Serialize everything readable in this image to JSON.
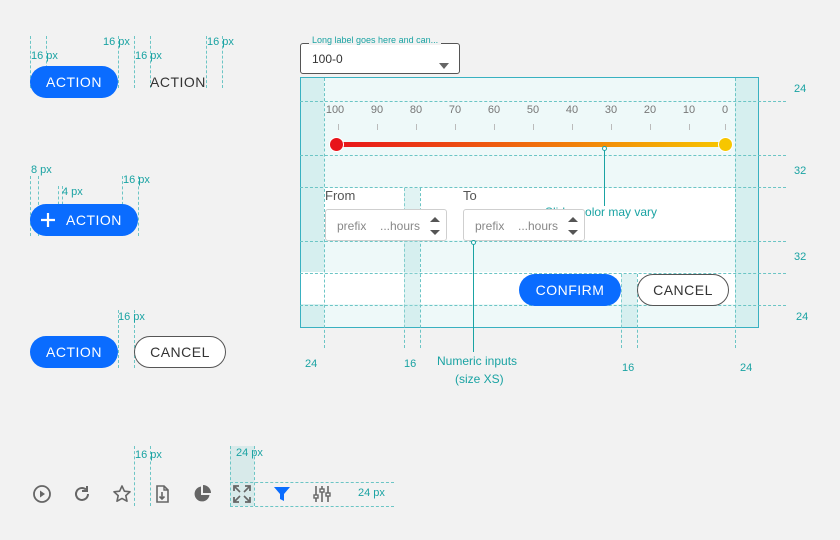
{
  "buttons": {
    "action_label": "ACTION",
    "cancel_label": "CANCEL",
    "confirm_label": "CONFIRM"
  },
  "spacing_labels": {
    "px16": "16 px",
    "px8": "8 px",
    "px4": "4 px",
    "px24": "24 px"
  },
  "select": {
    "floating_label": "Long label goes here and can...",
    "value": "100-0"
  },
  "slider": {
    "ticks": [
      "100",
      "90",
      "80",
      "70",
      "60",
      "50",
      "40",
      "30",
      "20",
      "10",
      "0"
    ],
    "range_min": 100,
    "range_max": 0,
    "start_color": "#e8141a",
    "end_color": "#f7c600",
    "annotation": "Slider color may vary"
  },
  "inputs": {
    "from_label": "From",
    "to_label": "To",
    "prefix": "prefix",
    "value": "...",
    "suffix": "hours",
    "annotation_line1": "Numeric inputs",
    "annotation_line2": "(size XS)"
  },
  "measures": {
    "right_24_top": "24",
    "right_32_a": "32",
    "right_32_b": "32",
    "right_24_bottom": "24",
    "bottom_24_left": "24",
    "bottom_16_a": "16",
    "bottom_16_b": "16",
    "bottom_24_right": "24"
  },
  "colors": {
    "primary": "#0a6cff",
    "measure": "#1aa3a3",
    "panel_border": "#39b1c1"
  },
  "icons": [
    "play-circle-icon",
    "refresh-icon",
    "star-icon",
    "file-export-icon",
    "pie-chart-icon",
    "expand-icon",
    "filter-icon",
    "sliders-icon"
  ]
}
